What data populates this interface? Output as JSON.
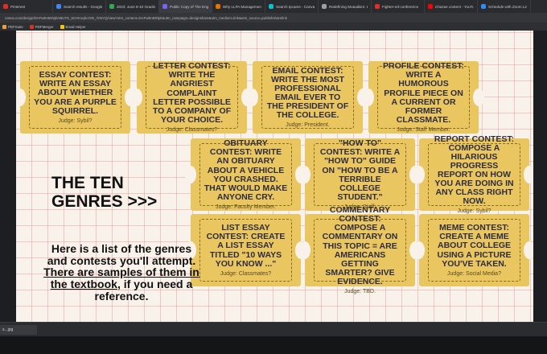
{
  "browser": {
    "tabs": [
      {
        "label": "Pinterest",
        "color": "#e02e2e",
        "active": false
      },
      {
        "label": "Search results - Google",
        "color": "#4285f4",
        "active": false
      },
      {
        "label": "2023: June 8-10 Grading",
        "color": "#34a853",
        "active": false
      },
      {
        "label": "Public Copy of The Engl",
        "color": "#7b61ff",
        "active": true
      },
      {
        "label": "Why LLPA Management",
        "color": "#e37400",
        "active": false
      },
      {
        "label": "Search tpcame - Canva",
        "color": "#00c4cc",
        "active": false
      },
      {
        "label": "Redefining Mutualism: Lan",
        "color": "#9aa0a6",
        "active": false
      },
      {
        "label": "Fighter-ed-conference",
        "color": "#e02e2e",
        "active": false
      },
      {
        "label": "Chazas content - YouTube",
        "color": "#ff0000",
        "active": false
      },
      {
        "label": "Schedule with Zoom Lim",
        "color": "#2d8cff",
        "active": false
      }
    ],
    "url": "canva.com/design/DAFwEntDNjE/s8UTE_6CHKsqhcOrE_/XNYQ/view?utm_content=DAFwEntDNjE&utm_campaign=designshare&utm_medium=link&utm_source=publishsharelink",
    "bookmarks": [
      {
        "label": "PDFSuite",
        "color": "#e8a33d"
      },
      {
        "label": "PDFMerger",
        "color": "#d93025"
      },
      {
        "label": "Email Helper",
        "color": "#f4c20d"
      }
    ]
  },
  "slide": {
    "headline": "THE TEN GENRES >>>",
    "intro_plain": "Here is a list of the genres and contests you'll attempt.",
    "intro_underlined": "There are samples of them in the textbook",
    "intro_tail": ", if you need a reference.",
    "tickets": [
      {
        "title": "ESSAY CONTEST: WRITE AN ESSAY ABOUT WHETHER YOU ARE A PURPLE SQUIRREL.",
        "judge": "Judge: Sybil?"
      },
      {
        "title": "LETTER CONTEST: WRITE THE ANGRIEST COMPLAINT LETTER POSSIBLE TO A COMPANY OF YOUR CHOICE.",
        "judge": "Judge: Classmates?"
      },
      {
        "title": "EMAIL CONTEST: WRITE THE MOST PROFESSIONAL EMAIL EVER TO THE PRESIDENT OF THE COLLEGE.",
        "judge": "Judge: President."
      },
      {
        "title": "PROFILE CONTEST: WRITE A HUMOROUS PROFILE PIECE ON A CURRENT OR FORMER CLASSMATE.",
        "judge": "Judge: Staff Member."
      },
      {
        "title": "OBITUARY CONTEST: WRITE AN OBITUARY ABOUT A VEHICLE YOU CRASHED. THAT WOULD MAKE ANYONE CRY.",
        "judge": "Judge: Faculty Member."
      },
      {
        "title": "\"HOW TO\" CONTEST: WRITE A \"HOW TO\" GUIDE ON \"HOW TO BE A TERRIBLE COLLEGE STUDENT.\"",
        "judge": "Judge: Staff."
      },
      {
        "title": "REPORT CONTEST: COMPOSE A HILARIOUS PROGRESS REPORT ON HOW YOU ARE DOING IN ANY CLASS RIGHT NOW.",
        "judge": "Judge: Sybil?"
      },
      {
        "title": "LIST ESSAY CONTEST: CREATE A LIST ESSAY TITLED \"10 WAYS YOU KNOW ...\"",
        "judge": "Judge: Classmates?"
      },
      {
        "title": "COMMENTARY CONTEST: COMPOSE A COMMENTARY ON THIS TOPIC = ARE AMERICANS GETTING SMARTER? GIVE EVIDENCE.",
        "judge": "Judge: TBD."
      },
      {
        "title": "MEME CONTEST: CREATE A MEME ABOUT COLLEGE USING A PICTURE YOU'VE TAKEN.",
        "judge": "Judge: Social Media?"
      }
    ]
  },
  "downloads": {
    "file_label": "s...jpg"
  }
}
